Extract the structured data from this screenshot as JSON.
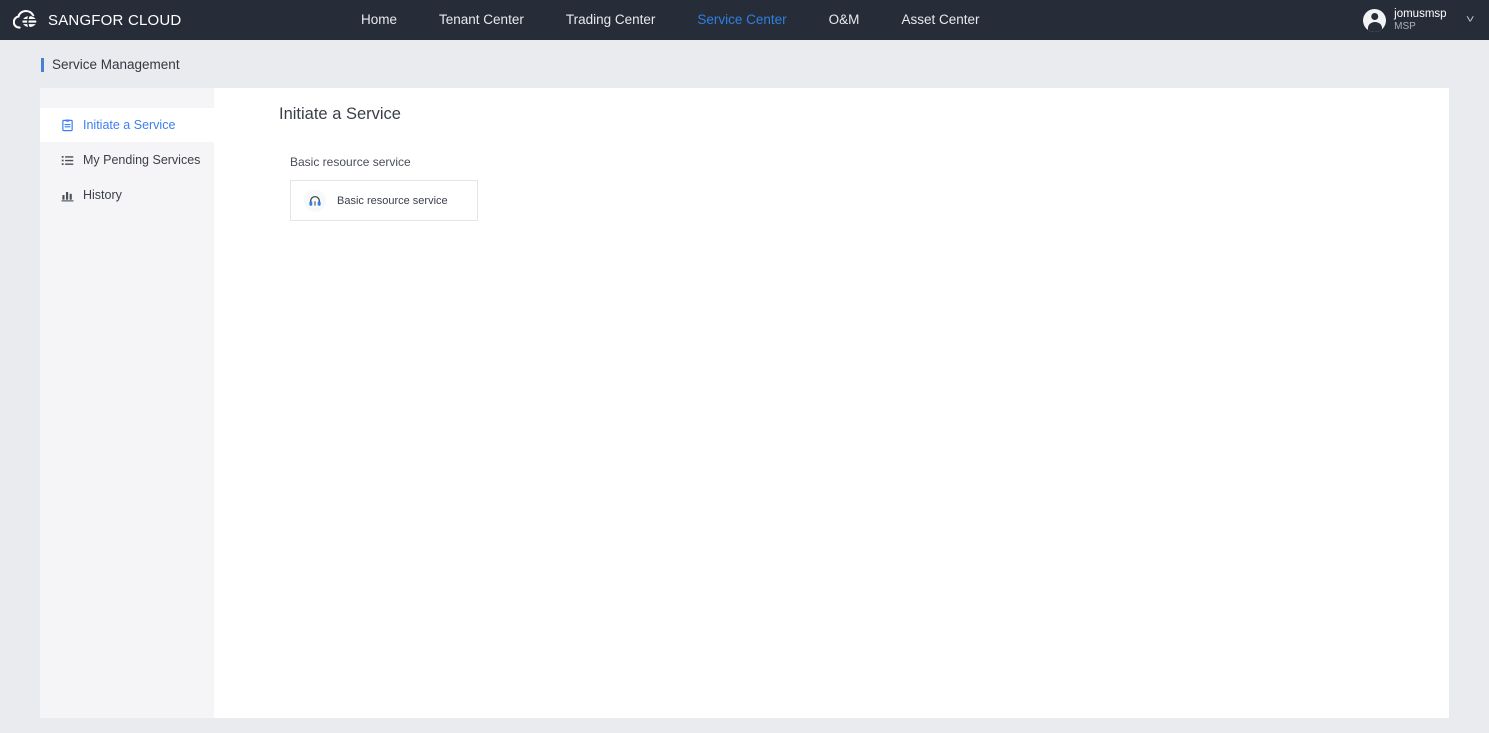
{
  "header": {
    "brand": {
      "logo_icon": "cloud-globe-logo-icon",
      "name": "SANGFOR CLOUD"
    },
    "nav": [
      {
        "label": "Home",
        "active": false
      },
      {
        "label": "Tenant Center",
        "active": false
      },
      {
        "label": "Trading Center",
        "active": false
      },
      {
        "label": "Service Center",
        "active": true
      },
      {
        "label": "O&M",
        "active": false
      },
      {
        "label": "Asset Center",
        "active": false
      }
    ],
    "user": {
      "avatar_icon": "user-avatar-icon",
      "name": "jomusmsp",
      "role": "MSP",
      "chevron_icon": "chevron-down-icon"
    }
  },
  "breadcrumb": {
    "text": "Service Management"
  },
  "sidebar": {
    "items": [
      {
        "label": "Initiate a Service",
        "icon": "form-document-icon",
        "active": true
      },
      {
        "label": "My Pending Services",
        "icon": "list-icon",
        "active": false
      },
      {
        "label": "History",
        "icon": "bar-chart-icon",
        "active": false
      }
    ]
  },
  "main": {
    "title": "Initiate a Service",
    "sections": [
      {
        "label": "Basic resource service",
        "cards": [
          {
            "label": "Basic resource service",
            "icon": "headset-icon"
          }
        ]
      }
    ]
  },
  "colors": {
    "header_bg": "#262d38",
    "page_bg": "#eaebef",
    "panel_bg": "#ffffff",
    "sidebar_bg": "#f5f5f7",
    "accent_blue": "#3d7ff0",
    "nav_active": "#2f7fe0",
    "crumb_accent": "#4a7fd4"
  }
}
